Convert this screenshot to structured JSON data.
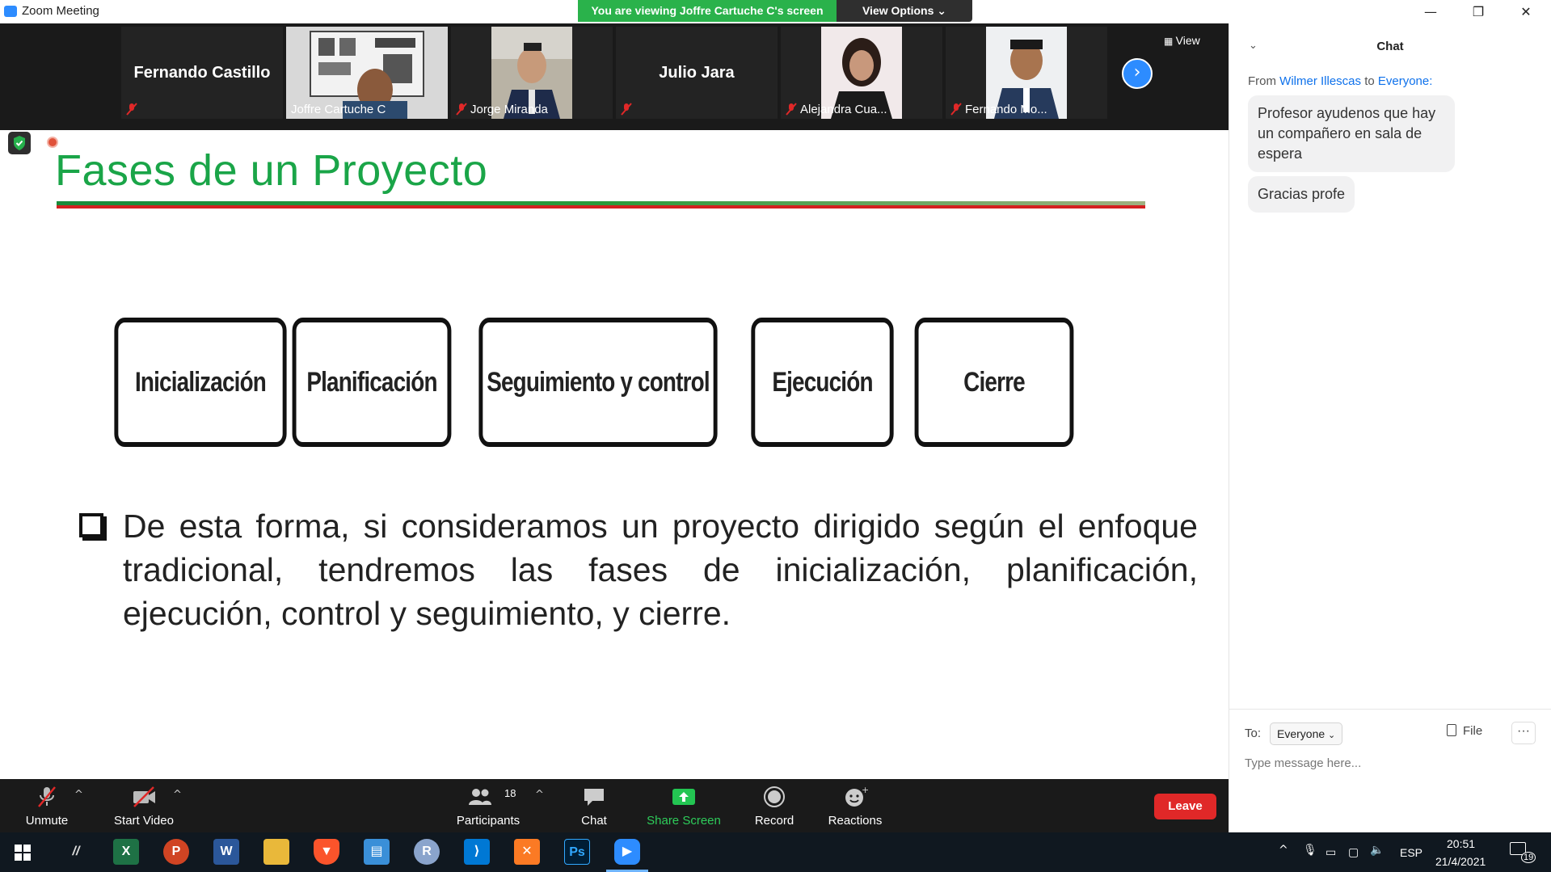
{
  "window": {
    "title": "Zoom Meeting",
    "minimize": "—",
    "maximize": "❐",
    "close": "✕"
  },
  "banner": {
    "viewing": "You are viewing Joffre Cartuche C's screen",
    "view_options": "View Options ⌄"
  },
  "strip": {
    "tiles": [
      {
        "name": "Fernando Castillo",
        "mode": "name"
      },
      {
        "name": "Joffre Cartuche C",
        "mode": "video",
        "active": true
      },
      {
        "name": "Jorge Miranda",
        "mode": "video"
      },
      {
        "name": "Julio Jara",
        "mode": "name"
      },
      {
        "name": "Alejandra Cua...",
        "mode": "video"
      },
      {
        "name": "Fernando Mo...",
        "mode": "video"
      }
    ],
    "view_label": "View"
  },
  "slide": {
    "title": "Fases de un Proyecto",
    "phases": [
      "Inicialización",
      "Planificación",
      "Seguimiento y control",
      "Ejecución",
      "Cierre"
    ],
    "body": "De esta forma, si consideramos un proyecto dirigido según el enfoque tradicional, tendremos las fases de inicialización, planificación, ejecución, control y seguimiento, y cierre."
  },
  "toolbar": {
    "unmute": "Unmute",
    "start_video": "Start Video",
    "participants": "Participants",
    "participants_count": "18",
    "chat": "Chat",
    "share_screen": "Share Screen",
    "record": "Record",
    "reactions": "Reactions",
    "leave": "Leave"
  },
  "chat": {
    "title": "Chat",
    "from_prefix": "From",
    "from_name": "Wilmer Illescas",
    "to_word": "to",
    "to_name": "Everyone:",
    "messages": [
      "Profesor ayudenos que hay un compañero en sala de espera",
      "Gracias profe"
    ],
    "to_label": "To:",
    "recipient": "Everyone",
    "file_label": "File",
    "more_label": "···",
    "input_placeholder": "Type message here..."
  },
  "taskbar": {
    "language": "ESP",
    "time": "20:51",
    "date": "21/4/2021",
    "notifications": "19"
  },
  "colors": {
    "accent": "#2d8cff",
    "title_green": "#1aa548",
    "banner_green": "#2ab24b",
    "leave_red": "#e02828"
  }
}
